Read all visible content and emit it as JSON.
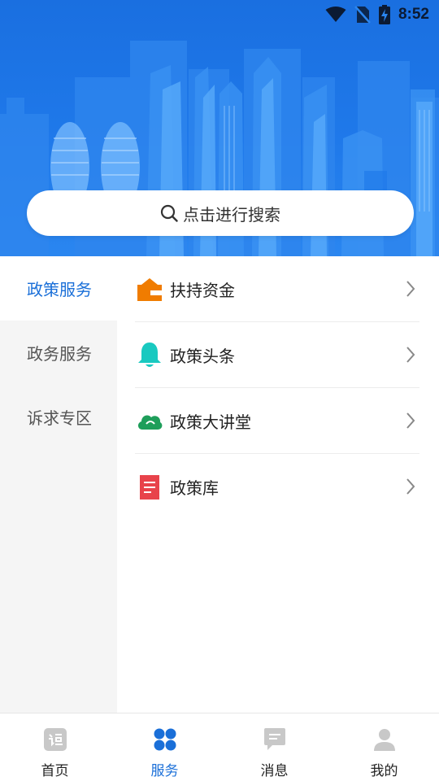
{
  "status_bar": {
    "time": "8:52",
    "icons": [
      "wifi-icon",
      "no-sim-icon",
      "battery-charging-icon"
    ]
  },
  "search": {
    "placeholder": "点击进行搜索",
    "icon": "search-icon"
  },
  "sidebar": {
    "items": [
      {
        "label": "政策服务",
        "active": true
      },
      {
        "label": "政务服务",
        "active": false
      },
      {
        "label": "诉求专区",
        "active": false
      }
    ]
  },
  "menu": {
    "items": [
      {
        "label": "扶持资金",
        "icon": "wallet-icon",
        "icon_color": "#f07c00"
      },
      {
        "label": "政策头条",
        "icon": "bell-icon",
        "icon_color": "#19c9c0"
      },
      {
        "label": "政策大讲堂",
        "icon": "cloud-icon",
        "icon_color": "#1e9e5a"
      },
      {
        "label": "政策库",
        "icon": "document-icon",
        "icon_color": "#e8434b"
      }
    ]
  },
  "bottom_nav": {
    "items": [
      {
        "label": "首页",
        "icon": "home-icon",
        "active": false
      },
      {
        "label": "服务",
        "icon": "services-grid-icon",
        "active": true
      },
      {
        "label": "消息",
        "icon": "message-icon",
        "active": false
      },
      {
        "label": "我的",
        "icon": "profile-icon",
        "active": false
      }
    ]
  },
  "colors": {
    "primary": "#1a6fd8",
    "hero_blue": "#1f79ea",
    "sidebar_bg": "#f5f5f5",
    "inactive_icon": "#c8c8c8"
  }
}
